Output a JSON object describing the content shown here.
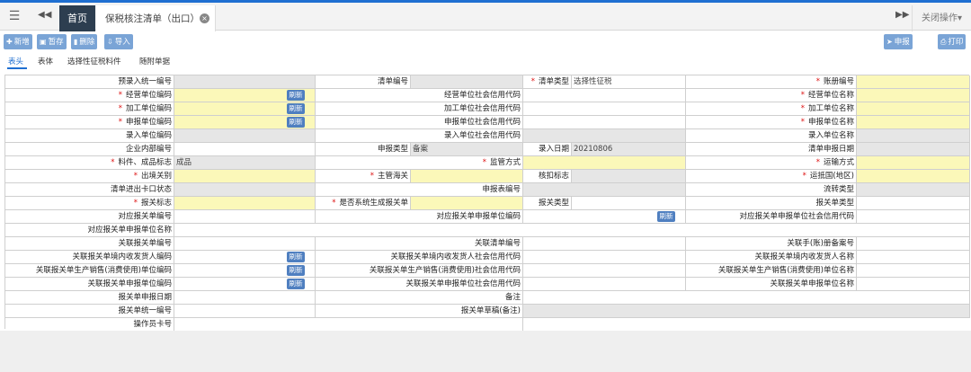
{
  "tabbar": {
    "menu_icon": "☰",
    "back_icon": "◀◀",
    "home_label": "首页",
    "doc_tab_label": "保税核注清单（出口）",
    "close_icon": "×",
    "forward_icon": "▶▶",
    "close_ops_label": "关闭操作▾"
  },
  "toolbar": {
    "add": "新增",
    "save": "暂存",
    "delete": "删除",
    "import": "导入",
    "declare": "申报",
    "print": "打印"
  },
  "subtabs": [
    "表头",
    "表体",
    "选择性征税料件",
    "随附单据"
  ],
  "refresh_label": "刷新",
  "form": {
    "r1": {
      "l1": "预录入统一编号",
      "l2": "清单编号",
      "l3": "清单类型",
      "v3": "选择性征税",
      "l4": "账册编号"
    },
    "r2": {
      "l1": "经营单位编码",
      "l2": "经营单位社会信用代码",
      "l3": "经营单位名称"
    },
    "r3": {
      "l1": "加工单位编码",
      "l2": "加工单位社会信用代码",
      "l3": "加工单位名称"
    },
    "r4": {
      "l1": "申报单位编码",
      "l2": "申报单位社会信用代码",
      "l3": "申报单位名称"
    },
    "r5": {
      "l1": "录入单位编码",
      "l2": "录入单位社会信用代码",
      "l3": "录入单位名称"
    },
    "r6": {
      "l1": "企业内部编号",
      "l2": "申报类型",
      "v2": "备案",
      "l3": "录入日期",
      "v3": "20210806",
      "l4": "清单申报日期"
    },
    "r7": {
      "l1": "料件、成品标志",
      "v1": "成品",
      "l2": "监管方式",
      "l3": "运输方式"
    },
    "r8": {
      "l1": "出境关别",
      "l2": "主管海关",
      "l3": "核扣标志",
      "l4": "运抵国(地区)"
    },
    "r9": {
      "l1": "清单进出卡口状态",
      "l2": "申报表编号",
      "l3": "流转类型"
    },
    "r10": {
      "l1": "报关标志",
      "l2": "是否系统生成报关单",
      "l3": "报关类型",
      "l4": "报关单类型"
    },
    "r11": {
      "l1": "对应报关单编号",
      "l2": "对应报关单申报单位编码",
      "l3": "对应报关单申报单位社会信用代码"
    },
    "r12": {
      "l1": "对应报关单申报单位名称"
    },
    "r13": {
      "l1": "关联报关单编号",
      "l2": "关联清单编号",
      "l3": "关联手(账)册备案号"
    },
    "r14": {
      "l1": "关联报关单境内收发货人编码",
      "l2": "关联报关单境内收发货人社会信用代码",
      "l3": "关联报关单境内收发货人名称"
    },
    "r15": {
      "l1": "关联报关单生产销售(消费使用)单位编码",
      "l2": "关联报关单生产销售(消费使用)社会信用代码",
      "l3": "关联报关单生产销售(消费使用)单位名称"
    },
    "r16": {
      "l1": "关联报关单申报单位编码",
      "l2": "关联报关单申报单位社会信用代码",
      "l3": "关联报关单申报单位名称"
    },
    "r17": {
      "l1": "报关单申报日期",
      "l2": "备注"
    },
    "r18": {
      "l1": "报关单统一编号",
      "l2": "报关单草稿(备注)"
    },
    "r19": {
      "l1": "操作员卡号"
    }
  },
  "colors": {
    "accent": "#1f6fd1",
    "required_bg": "#fbf8b9",
    "readonly_bg": "#e6e6e6",
    "button_bg": "#7aa4d6"
  }
}
